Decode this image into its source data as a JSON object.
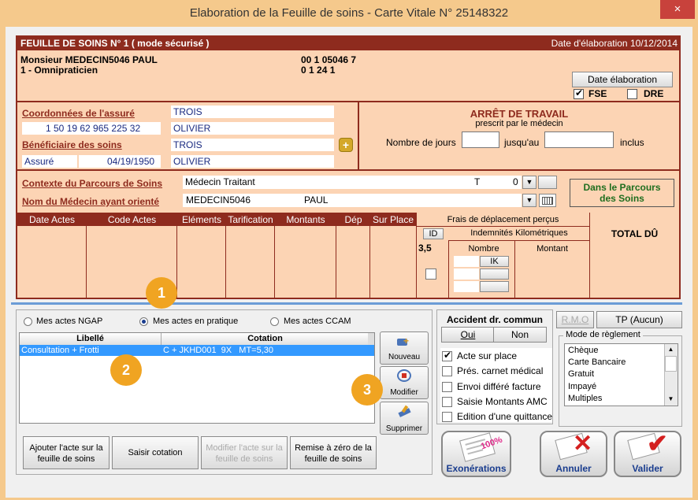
{
  "window": {
    "title": "Elaboration de la Feuille de soins - Carte Vitale N° 25148322",
    "close": "×"
  },
  "header": {
    "left": "FEUILLE DE SOINS  N° 1 ( mode sécurisé )",
    "right": "Date d'élaboration 10/12/2014"
  },
  "doctor": {
    "name": "Monsieur MEDECIN5046 PAUL",
    "specialty": "1 - Omnipraticien",
    "code1": "00 1 05046 7",
    "code2": "0 1 24 1"
  },
  "date_button": "Date élaboration",
  "fse_label": "FSE",
  "dre_label": "DRE",
  "insured": {
    "coord_label": "Coordonnées de l'assuré",
    "nir": "1 50 19 62 965 225 32",
    "beneficiary_label": "Bénéficiaire des soins",
    "status": "Assuré",
    "birthdate": "04/19/1950",
    "last_name": "TROIS",
    "first_name": "OLIVIER",
    "ben_last_name": "TROIS",
    "ben_first_name": "OLIVIER"
  },
  "arret": {
    "title": "ARRÊT DE TRAVAIL",
    "subtitle": "prescrit par le médecin",
    "days_label": "Nombre de jours",
    "until_label": "jusqu'au",
    "inclusive_label": "inclus"
  },
  "parcours": {
    "context_label": "Contexte du Parcours de Soins",
    "context_value": "Médecin Traitant",
    "context_t": "T",
    "context_0": "0",
    "doctor_label": "Nom du Médecin ayant orienté",
    "doctor_last": "MEDECIN5046",
    "doctor_first": "PAUL",
    "status": "Dans le Parcours des Soins"
  },
  "acts_table": {
    "columns": [
      "Date Actes",
      "Code Actes",
      "Eléments",
      "Tarification",
      "Montants",
      "Dép",
      "Sur Place"
    ],
    "frais_label": "Frais de déplacement perçus",
    "id_label": "ID",
    "indemnites_label": "Indemnités Kilométriques",
    "value": "3,5",
    "nombre_label": "Nombre",
    "montant_label": "Montant",
    "ik_label": "IK",
    "total_label": "TOTAL DÛ"
  },
  "mode_radios": [
    {
      "label": "Mes actes NGAP",
      "selected": false
    },
    {
      "label": "Mes actes en pratique",
      "selected": true
    },
    {
      "label": "Mes actes CCAM",
      "selected": false
    }
  ],
  "grid": {
    "col1": "Libellé",
    "col2": "Cotation",
    "rows": [
      {
        "libelle": "Consultation + Frotti",
        "cotation": "C + JKHD001  9X   MT=5,30"
      }
    ]
  },
  "side_buttons": {
    "new": "Nouveau",
    "modify": "Modifier",
    "delete": "Supprimer"
  },
  "bottom_buttons": {
    "add": "Ajouter l'acte sur la feuille de soins",
    "enter": "Saisir cotation",
    "modify": "Modifier l'acte sur la feuille de soins",
    "reset": "Remise à zéro de la feuille de soins"
  },
  "accident": {
    "title": "Accident dr. commun",
    "yes": "Oui",
    "no": "Non"
  },
  "options": [
    {
      "label": "Acte sur place",
      "checked": true
    },
    {
      "label": "Prés. carnet médical",
      "checked": false
    },
    {
      "label": "Envoi différé facture",
      "checked": false
    },
    {
      "label": "Saisie Montants AMC",
      "checked": false
    },
    {
      "label": "Edition d'une quittance",
      "checked": false
    }
  ],
  "rmo_button": "R.M.O",
  "tp_button": "TP (Aucun)",
  "payment": {
    "title": "Mode de règlement",
    "options": [
      "Chèque",
      "Carte Bancaire",
      "Gratuit",
      "Impayé",
      "Multiples"
    ]
  },
  "action_buttons": {
    "exo": "Exonérations",
    "cancel": "Annuler",
    "validate": "Valider",
    "stamp": "100%"
  },
  "badges": [
    "1",
    "2",
    "3"
  ]
}
